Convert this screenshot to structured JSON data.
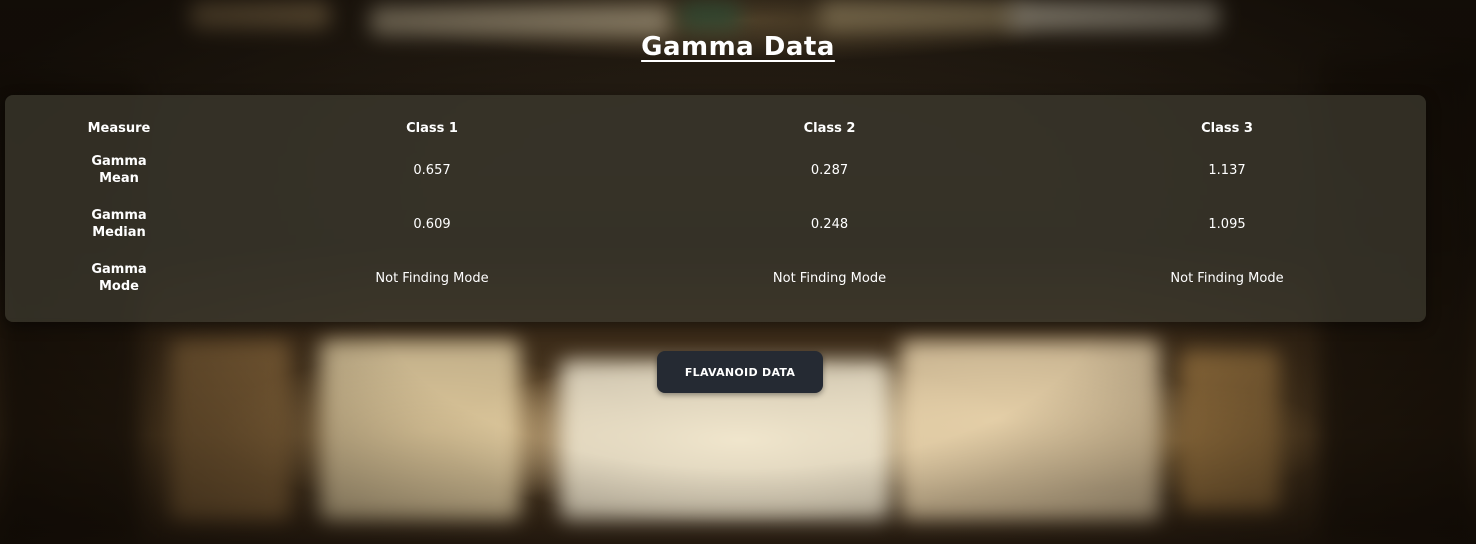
{
  "page": {
    "title": "Gamma Data"
  },
  "table": {
    "headers": [
      "Measure",
      "Class 1",
      "Class 2",
      "Class 3"
    ],
    "rows": [
      {
        "measure": "Gamma Mean",
        "class1": "0.657",
        "class2": "0.287",
        "class3": "1.137"
      },
      {
        "measure": "Gamma Median",
        "class1": "0.609",
        "class2": "0.248",
        "class3": "1.095"
      },
      {
        "measure": "Gamma Mode",
        "class1": "Not Finding Mode",
        "class2": "Not Finding Mode",
        "class3": "Not Finding Mode"
      }
    ]
  },
  "actions": {
    "next_button_label": "FLAVANOID DATA"
  },
  "colors": {
    "panel_background": "#3e3c30",
    "button_background": "#252a33",
    "text": "#ffffff"
  }
}
